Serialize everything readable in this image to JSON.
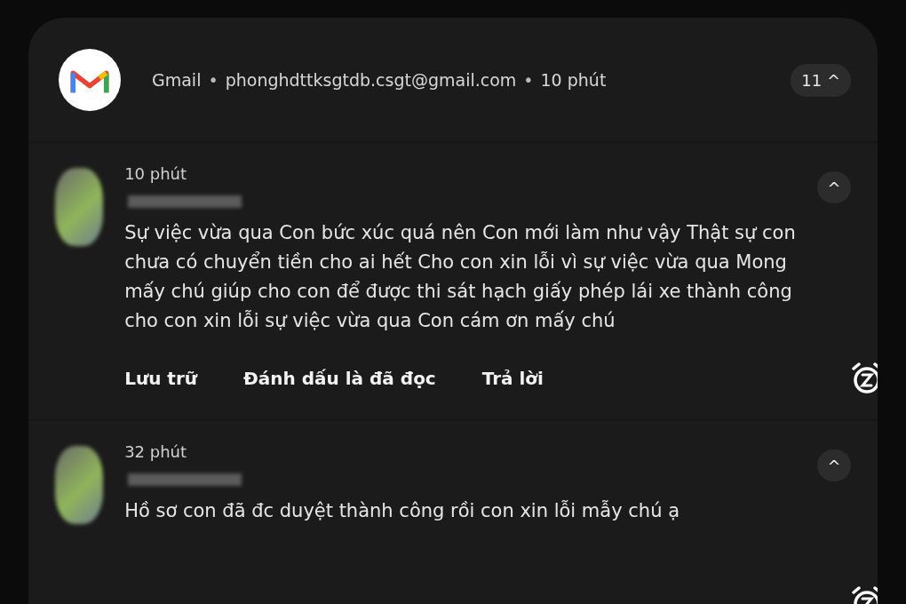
{
  "header": {
    "app": "Gmail",
    "separator_1": "•",
    "account": "phonghdttksgtdb.csgt@gmail.com",
    "separator_2": "•",
    "time": "10 phút",
    "count": "11",
    "caret": "^"
  },
  "messages": [
    {
      "time": "10 phút",
      "body": "Sự việc vừa qua Con bức xúc quá nên Con mới làm như vậy Thật sự con chưa có chuyển tiền cho ai hết Cho con xin lỗi vì sự việc vừa qua Mong mấy chú giúp cho con để được thi sát hạch giấy phép lái xe thành công cho con xin lỗi sự việc vừa qua Con cám ơn mấy chú",
      "actions": [
        "Lưu trữ",
        "Đánh dấu là đã đọc",
        "Trả lời"
      ]
    },
    {
      "time": "32 phút",
      "body": "Hồ sơ con đã đc duyệt thành công rồi con xin lỗi mẫy chú ạ"
    }
  ]
}
